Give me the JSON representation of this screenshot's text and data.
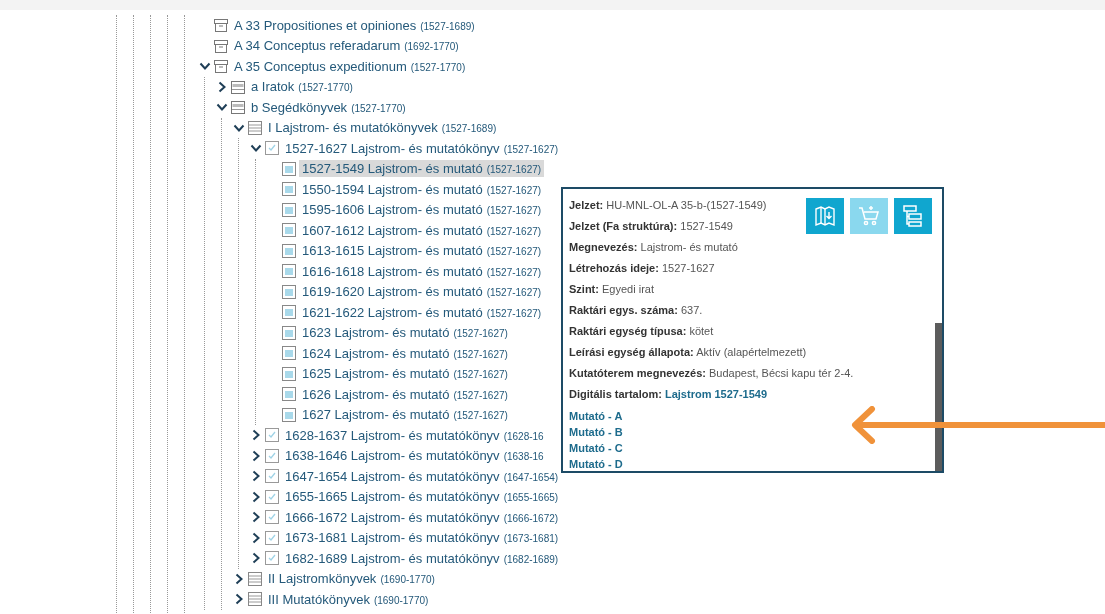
{
  "tree": [
    {
      "label": "A 33 Propositiones et opiniones",
      "dates": "(1527-1689)",
      "kind": "box",
      "selected": false
    },
    {
      "label": "A 34 Conceptus referadarum",
      "dates": "(1692-1770)",
      "kind": "box",
      "selected": false
    },
    {
      "label": "A 35 Conceptus expeditionum",
      "dates": "(1527-1770)",
      "kind": "box",
      "selected": false,
      "expanded": true,
      "children": [
        {
          "label": "a Iratok",
          "dates": "(1527-1770)",
          "kind": "shelf",
          "selected": false,
          "expanded": false
        },
        {
          "label": "b Segédkönyvek",
          "dates": "(1527-1770)",
          "kind": "shelf",
          "selected": false,
          "expanded": true,
          "children": [
            {
              "label": "I Lajstrom- és mutatókönyvek",
              "dates": "(1527-1689)",
              "kind": "series",
              "selected": false,
              "expanded": true,
              "children": [
                {
                  "label": "1527-1627 Lajstrom- és mutatókönyv",
                  "dates": "(1527-1627)",
                  "kind": "volume",
                  "selected": false,
                  "expanded": true,
                  "children": [
                    {
                      "label": "1527-1549 Lajstrom- és mutató",
                      "dates": "(1527-1627)",
                      "kind": "item",
                      "selected": true
                    },
                    {
                      "label": "1550-1594 Lajstrom- és mutató",
                      "dates": "(1527-1627)",
                      "kind": "item",
                      "selected": false
                    },
                    {
                      "label": "1595-1606 Lajstrom- és mutató",
                      "dates": "(1527-1627)",
                      "kind": "item",
                      "selected": false
                    },
                    {
                      "label": "1607-1612 Lajstrom- és mutató",
                      "dates": "(1527-1627)",
                      "kind": "item",
                      "selected": false
                    },
                    {
                      "label": "1613-1615 Lajstrom- és mutató",
                      "dates": "(1527-1627)",
                      "kind": "item",
                      "selected": false
                    },
                    {
                      "label": "1616-1618 Lajstrom- és mutató",
                      "dates": "(1527-1627)",
                      "kind": "item",
                      "selected": false
                    },
                    {
                      "label": "1619-1620 Lajstrom- és mutató",
                      "dates": "(1527-1627)",
                      "kind": "item",
                      "selected": false
                    },
                    {
                      "label": "1621-1622 Lajstrom- és mutató",
                      "dates": "(1527-1627)",
                      "kind": "item",
                      "selected": false
                    },
                    {
                      "label": "1623 Lajstrom- és mutató",
                      "dates": "(1527-1627)",
                      "kind": "item",
                      "selected": false
                    },
                    {
                      "label": "1624 Lajstrom- és mutató",
                      "dates": "(1527-1627)",
                      "kind": "item",
                      "selected": false
                    },
                    {
                      "label": "1625 Lajstrom- és mutató",
                      "dates": "(1527-1627)",
                      "kind": "item",
                      "selected": false
                    },
                    {
                      "label": "1626 Lajstrom- és mutató",
                      "dates": "(1527-1627)",
                      "kind": "item",
                      "selected": false
                    },
                    {
                      "label": "1627 Lajstrom- és mutató",
                      "dates": "(1527-1627)",
                      "kind": "item",
                      "selected": false
                    }
                  ]
                },
                {
                  "label": "1628-1637 Lajstrom- és mutatókönyv",
                  "dates": "(1628-16",
                  "kind": "volume",
                  "selected": false,
                  "expanded": false
                },
                {
                  "label": "1638-1646 Lajstrom- és mutatókönyv",
                  "dates": "(1638-16",
                  "kind": "volume",
                  "selected": false,
                  "expanded": false
                },
                {
                  "label": "1647-1654 Lajstrom- és mutatókönyv",
                  "dates": "(1647-1654)",
                  "kind": "volume",
                  "selected": false,
                  "expanded": false
                },
                {
                  "label": "1655-1665 Lajstrom- és mutatókönyv",
                  "dates": "(1655-1665)",
                  "kind": "volume",
                  "selected": false,
                  "expanded": false
                },
                {
                  "label": "1666-1672 Lajstrom- és mutatókönyv",
                  "dates": "(1666-1672)",
                  "kind": "volume",
                  "selected": false,
                  "expanded": false
                },
                {
                  "label": "1673-1681 Lajstrom- és mutatókönyv",
                  "dates": "(1673-1681)",
                  "kind": "volume",
                  "selected": false,
                  "expanded": false
                },
                {
                  "label": "1682-1689 Lajstrom- és mutatókönyv",
                  "dates": "(1682-1689)",
                  "kind": "volume",
                  "selected": false,
                  "expanded": false
                }
              ]
            },
            {
              "label": "II Lajstromkönyvek",
              "dates": "(1690-1770)",
              "kind": "series",
              "selected": false,
              "expanded": false
            },
            {
              "label": "III Mutatókönyvek",
              "dates": "(1690-1770)",
              "kind": "series",
              "selected": false,
              "expanded": false
            }
          ]
        }
      ]
    }
  ],
  "popup": {
    "actions": [
      {
        "kind": "viewer",
        "disabled": false
      },
      {
        "kind": "cart",
        "disabled": true
      },
      {
        "kind": "tree",
        "disabled": false
      }
    ],
    "fields": [
      {
        "label": "Jelzet:",
        "value": "HU-MNL-OL-A 35-b-(1527-1549)",
        "kind": "text"
      },
      {
        "label": "Jelzet (Fa struktúra):",
        "value": "1527-1549",
        "kind": "text"
      },
      {
        "label": "Megnevezés:",
        "value": "Lajstrom- és mutató",
        "kind": "text"
      },
      {
        "label": "Létrehozás ideje:",
        "value": "1527-1627",
        "kind": "text"
      },
      {
        "label": "Szint:",
        "value": "Egyedi irat",
        "kind": "text"
      },
      {
        "label": "Raktári egys. száma:",
        "value": "637.",
        "kind": "text"
      },
      {
        "label": "Raktári egység típusa:",
        "value": "kötet",
        "kind": "text"
      },
      {
        "label": "Leírási egység állapota:",
        "value": "Aktív (alapértelmezett)",
        "kind": "text"
      },
      {
        "label": "Kutatóterem megnevezés:",
        "value": "Budapest, Bécsi kapu tér 2-4.",
        "kind": "text"
      },
      {
        "label": "Digitális tartalom:",
        "value": "Lajstrom 1527-1549",
        "kind": "link"
      }
    ],
    "links": [
      "Mutató - A",
      "Mutató - B",
      "Mutató - C",
      "Mutató - D"
    ]
  }
}
